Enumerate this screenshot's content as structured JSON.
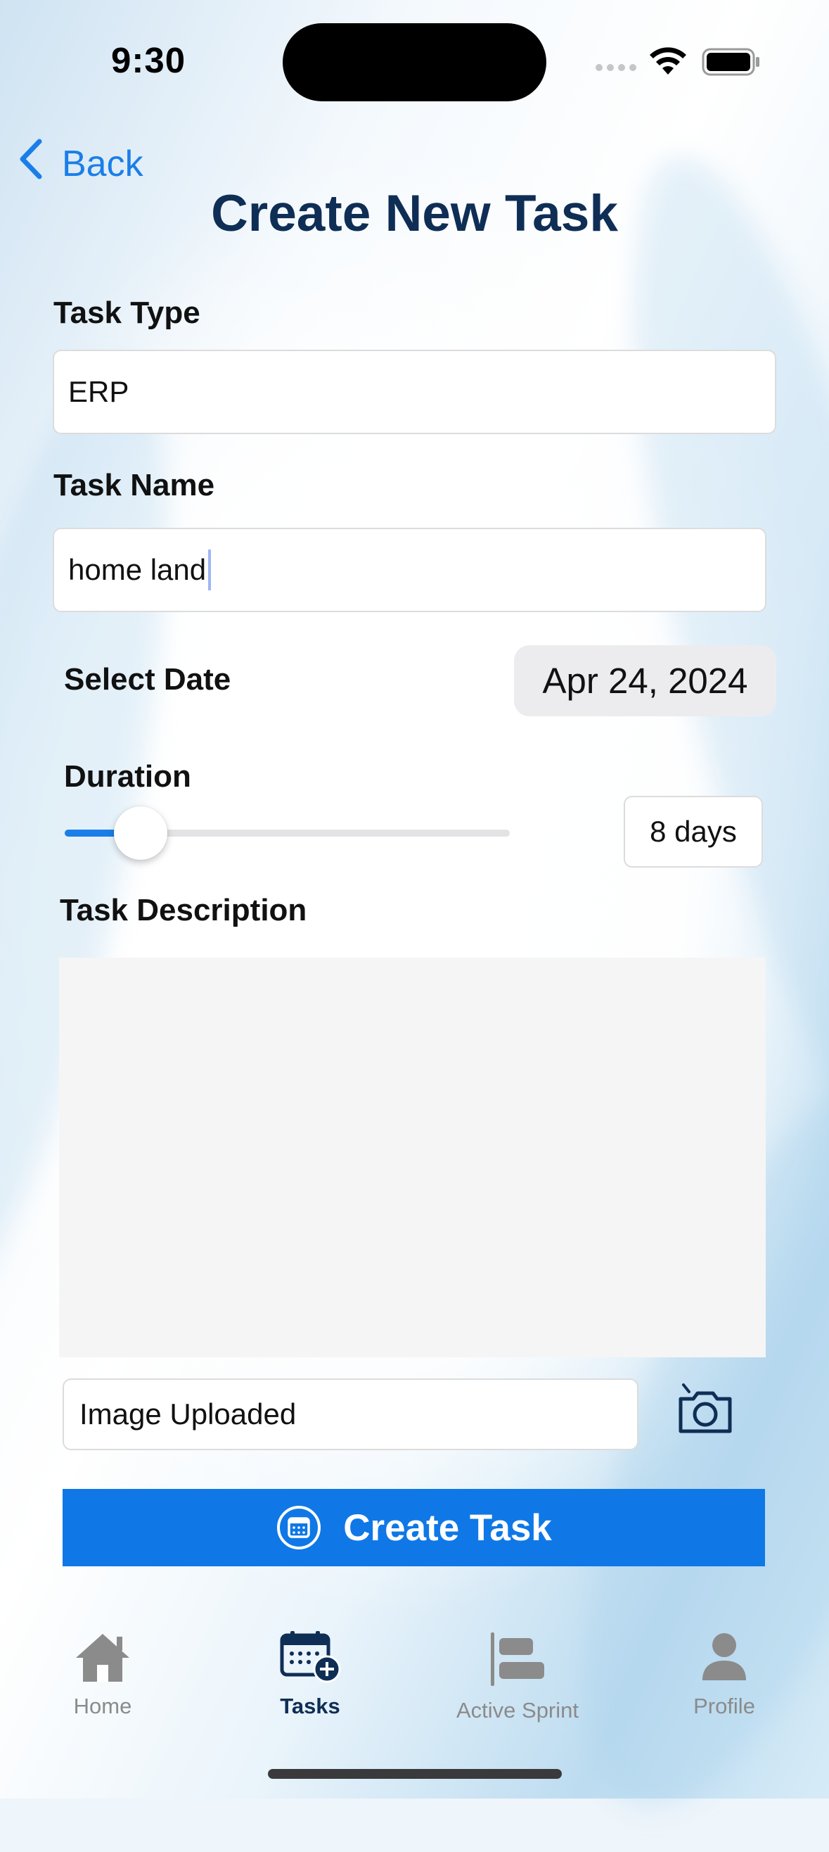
{
  "status_bar": {
    "time": "9:30"
  },
  "header": {
    "back_label": "Back",
    "title": "Create New Task"
  },
  "form": {
    "task_type": {
      "label": "Task Type",
      "value": "ERP"
    },
    "task_name": {
      "label": "Task Name",
      "value": "home land"
    },
    "date": {
      "label": "Select Date",
      "value": "Apr 24, 2024"
    },
    "duration": {
      "label": "Duration",
      "value_text": "8 days",
      "slider_fraction": 0.17
    },
    "description": {
      "label": "Task Description",
      "value": ""
    },
    "image": {
      "status": "Image Uploaded"
    },
    "submit_label": "Create Task"
  },
  "tab_bar": {
    "items": [
      {
        "label": "Home",
        "icon": "house-icon",
        "active": false
      },
      {
        "label": "Tasks",
        "icon": "calendar-add-icon",
        "active": true
      },
      {
        "label": "Active Sprint",
        "icon": "sprint-bars-icon",
        "active": false
      },
      {
        "label": "Profile",
        "icon": "person-icon",
        "active": false
      }
    ]
  },
  "colors": {
    "accent": "#0f78e6",
    "title": "#0f2e55",
    "inactive_tab": "#8b8b8b"
  }
}
